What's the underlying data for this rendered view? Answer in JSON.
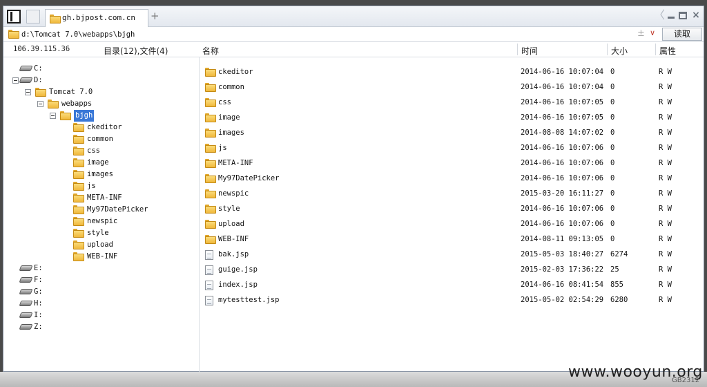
{
  "tab": {
    "title": "gh.bjpost.com.cn",
    "new_tab": "+"
  },
  "window_controls": {
    "back": "〈",
    "close": "×"
  },
  "address": {
    "path": "d:\\Tomcat 7.0\\webapps\\bjgh",
    "plusminus": "±",
    "dropdown": "∨",
    "read_button": "读取"
  },
  "header": {
    "ip": "106.39.115.36",
    "counts": "目录(12),文件(4)",
    "col_name": "名称",
    "col_time": "时间",
    "col_size": "大小",
    "col_attr": "属性"
  },
  "tree": {
    "drives_top": [
      "C:",
      "D:"
    ],
    "tomcat": "Tomcat 7.0",
    "webapps": "webapps",
    "current": "bjgh",
    "children": [
      "ckeditor",
      "common",
      "css",
      "image",
      "images",
      "js",
      "META-INF",
      "My97DatePicker",
      "newspic",
      "style",
      "upload",
      "WEB-INF"
    ],
    "drives_bottom": [
      "E:",
      "F:",
      "G:",
      "H:",
      "I:",
      "Z:"
    ]
  },
  "files": [
    {
      "name": "ckeditor",
      "time": "2014-06-16 10:07:04",
      "size": "0",
      "attr": "R W",
      "type": "folder"
    },
    {
      "name": "common",
      "time": "2014-06-16 10:07:04",
      "size": "0",
      "attr": "R W",
      "type": "folder"
    },
    {
      "name": "css",
      "time": "2014-06-16 10:07:05",
      "size": "0",
      "attr": "R W",
      "type": "folder"
    },
    {
      "name": "image",
      "time": "2014-06-16 10:07:05",
      "size": "0",
      "attr": "R W",
      "type": "folder"
    },
    {
      "name": "images",
      "time": "2014-08-08 14:07:02",
      "size": "0",
      "attr": "R W",
      "type": "folder"
    },
    {
      "name": "js",
      "time": "2014-06-16 10:07:06",
      "size": "0",
      "attr": "R W",
      "type": "folder"
    },
    {
      "name": "META-INF",
      "time": "2014-06-16 10:07:06",
      "size": "0",
      "attr": "R W",
      "type": "folder"
    },
    {
      "name": "My97DatePicker",
      "time": "2014-06-16 10:07:06",
      "size": "0",
      "attr": "R W",
      "type": "folder"
    },
    {
      "name": "newspic",
      "time": "2015-03-20 16:11:27",
      "size": "0",
      "attr": "R W",
      "type": "folder"
    },
    {
      "name": "style",
      "time": "2014-06-16 10:07:06",
      "size": "0",
      "attr": "R W",
      "type": "folder"
    },
    {
      "name": "upload",
      "time": "2014-06-16 10:07:06",
      "size": "0",
      "attr": "R W",
      "type": "folder"
    },
    {
      "name": "WEB-INF",
      "time": "2014-08-11 09:13:05",
      "size": "0",
      "attr": "R W",
      "type": "folder"
    },
    {
      "name": "bak.jsp",
      "time": "2015-05-03 18:40:27",
      "size": "6274",
      "attr": "R W",
      "type": "file"
    },
    {
      "name": "guige.jsp",
      "time": "2015-02-03 17:36:22",
      "size": "25",
      "attr": "R W",
      "type": "file"
    },
    {
      "name": "index.jsp",
      "time": "2014-06-16 08:41:54",
      "size": "855",
      "attr": "R W",
      "type": "file"
    },
    {
      "name": "mytesttest.jsp",
      "time": "2015-05-02 02:54:29",
      "size": "6280",
      "attr": "R W",
      "type": "file"
    }
  ],
  "encoding": "GB2312",
  "watermark": "www.wooyun.org",
  "colors": {
    "selection": "#3a78d7",
    "folder": "#f0b83c",
    "accent_dropdown": "#c0392b"
  }
}
